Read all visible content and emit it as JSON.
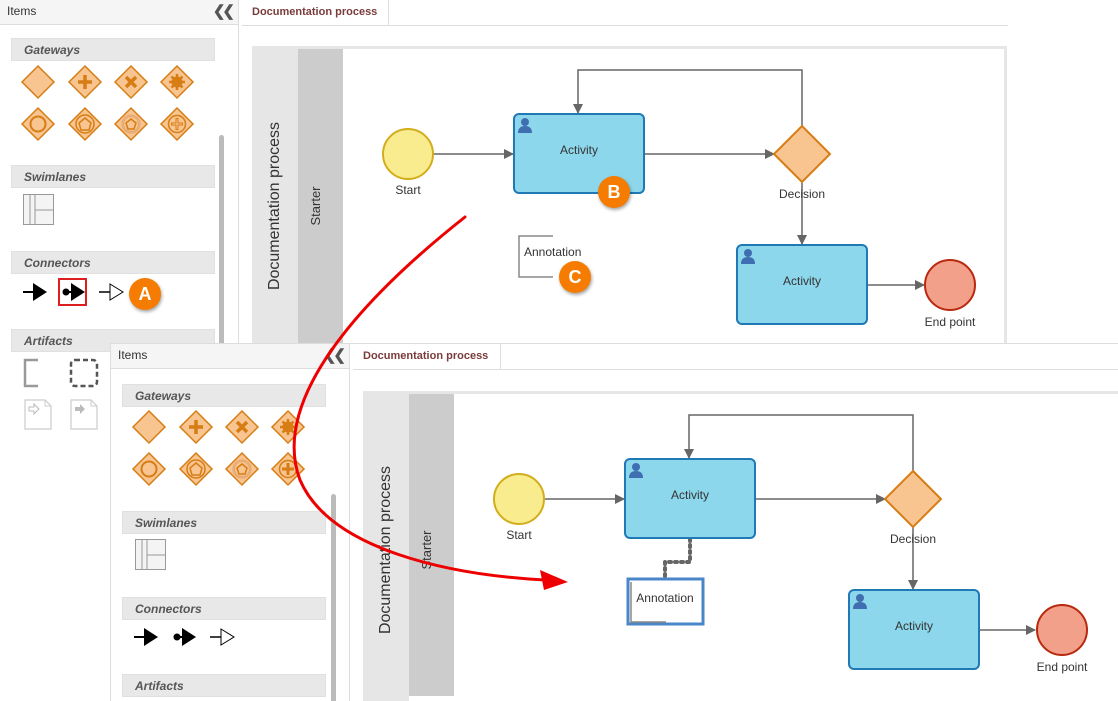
{
  "before": {
    "panel": {
      "title": "Items",
      "collapse_icon": "double-chevron-left-icon",
      "sections": [
        {
          "label": "Gateways",
          "items": [
            "exclusive-gateway",
            "parallel-gateway",
            "inclusive-x-gateway",
            "complex-gateway",
            "event-gateway",
            "event-based-gateway",
            "exclusive-event-gateway",
            "parallel-event-gateway"
          ]
        },
        {
          "label": "Swimlanes",
          "items": [
            "pool-lane"
          ]
        },
        {
          "label": "Connectors",
          "items": [
            "sequence-flow",
            "message-start-flow",
            "association-flow"
          ],
          "selected": "message-start-flow"
        },
        {
          "label": "Artifacts",
          "items": [
            "annotation",
            "group",
            "data-input",
            "data-output"
          ]
        }
      ]
    },
    "tab": "Documentation process",
    "pool": "Documentation process",
    "lane": "Starter",
    "diagram": {
      "start": "Start",
      "activity1": "Activity",
      "decision": "Decision",
      "activity2": "Activity",
      "end": "End point",
      "annotation": "Annotation"
    },
    "badges": {
      "a": "A",
      "b": "B",
      "c": "C"
    }
  },
  "after": {
    "panel": {
      "title": "Items",
      "sections": [
        "Gateways",
        "Swimlanes",
        "Connectors",
        "Artifacts"
      ]
    },
    "tab": "Documentation process",
    "pool": "Documentation process",
    "lane": "Starter",
    "diagram": {
      "start": "Start",
      "activity1": "Activity",
      "decision": "Decision",
      "activity2": "Activity",
      "end": "End point",
      "annotation": "Annotation"
    }
  },
  "colors": {
    "start_fill": "#f8ec8f",
    "start_stroke": "#d4ad1c",
    "activity_fill": "#8dd7ec",
    "activity_stroke": "#1f79b4",
    "gateway_fill": "#f8c490",
    "gateway_stroke": "#d67d14",
    "end_fill": "#f2a089",
    "end_stroke": "#b8290f",
    "flow": "#666666",
    "tab_text": "#7a3b3b",
    "badge": "#f57c00",
    "callout_arrow": "#ee0000"
  }
}
